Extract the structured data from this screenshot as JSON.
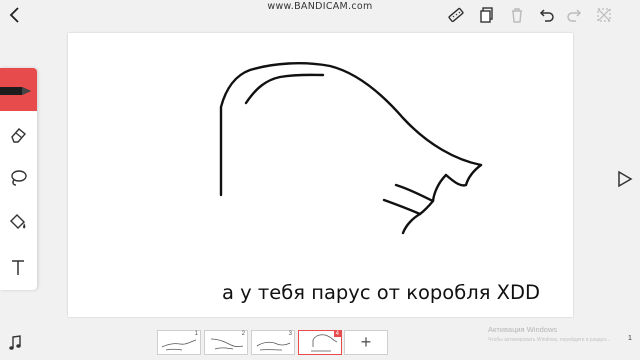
{
  "watermark": "www.BANDICAM.com",
  "caption": "а у тебя парус от коробля XDD",
  "frames": [
    {
      "number": "1"
    },
    {
      "number": "2"
    },
    {
      "number": "3"
    },
    {
      "number": "4",
      "active": true
    }
  ],
  "add_frame_label": "+",
  "windows_notice": {
    "title": "Активация Windows",
    "subtitle": "Чтобы активировать Windows, перейдите в раздел..."
  },
  "frame_counter": "1",
  "icons": {
    "back": "chevron-left-icon",
    "ruler": "ruler-icon",
    "copy": "copy-icon",
    "trash": "trash-icon",
    "undo": "undo-icon",
    "redo": "redo-icon",
    "grid": "grid-icon",
    "pen": "pen-icon",
    "eraser": "eraser-icon",
    "lasso": "lasso-icon",
    "fill": "fill-bucket-icon",
    "text": "text-icon",
    "play": "play-icon",
    "music": "music-note-icon"
  },
  "colors": {
    "accent": "#e74b4b",
    "background": "#f1f1f1",
    "canvas": "#ffffff"
  }
}
